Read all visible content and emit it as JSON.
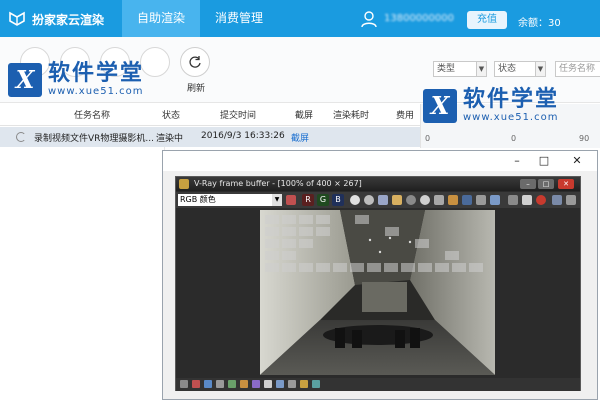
{
  "app": {
    "name": "扮家家云渲染",
    "nav_tabs": [
      "自助渲染",
      "消费管理"
    ],
    "active_tab": "自助渲染",
    "user_phone": "13800000000",
    "recharge_label": "充值",
    "balance_text": "余额：30"
  },
  "toolbar": {
    "refresh_label": "刷新",
    "filters": {
      "type_label": "类型",
      "status_label": "状态",
      "search_placeholder": "任务名称"
    }
  },
  "watermark": {
    "title": "软件学堂",
    "url": "www.xue51.com"
  },
  "table": {
    "headers": [
      "任务名称",
      "状态",
      "提交时间",
      "截屏",
      "渲染耗时",
      "费用"
    ],
    "rows": [
      {
        "name": "录制视频文件VR物理摄影机...",
        "status": "渲染中",
        "submit_time": "2016/9/3 16:33:26",
        "screenshot": "截屏"
      }
    ],
    "right_mini_values": [
      "0",
      "0",
      "90"
    ]
  },
  "frame_window": {
    "controls": [
      "–",
      "□",
      "✕"
    ]
  },
  "vray": {
    "title": "V-Ray frame buffer - [100% of 400 × 267]",
    "channel": "RGB 颜色",
    "rgb_buttons": [
      "R",
      "G",
      "B"
    ],
    "colors": {
      "red": "#c0392b",
      "green": "#3a7d3a",
      "blue": "#2e5fa8"
    }
  },
  "colors": {
    "brand": "#1a9be0",
    "active_tab": "#48b4ee",
    "watermark": "#1c5fb0",
    "row_highlight": "#dfe6ee"
  }
}
